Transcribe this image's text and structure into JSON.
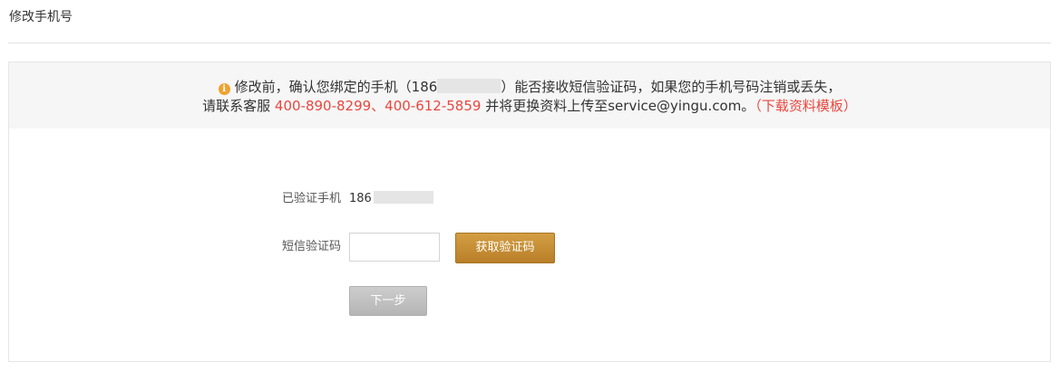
{
  "page": {
    "title": "修改手机号"
  },
  "notice": {
    "line1_before": "修改前，确认您绑定的手机（",
    "phone_prefix": "186",
    "line1_after": "）能否接收短信验证码，如果您的手机号码注销或丢失，",
    "line2_before": "请联系客服",
    "hotlines": "400-890-8299、400-612-5859",
    "line2_middle": "并将更换资料上传至service@yingu.com。",
    "template_link": "（下载资料模板）",
    "icon": "info-icon",
    "accent_color": "#e9473f",
    "icon_color": "#f0a22f"
  },
  "form": {
    "verified_phone_label": "已验证手机",
    "verified_phone_prefix": "186",
    "sms_code_label": "短信验证码",
    "sms_code_value": "",
    "sms_code_placeholder": "",
    "get_code_button": "获取验证码",
    "next_button": "下一步",
    "get_code_color": "#c8923a",
    "next_color": "#c2c2c2"
  }
}
